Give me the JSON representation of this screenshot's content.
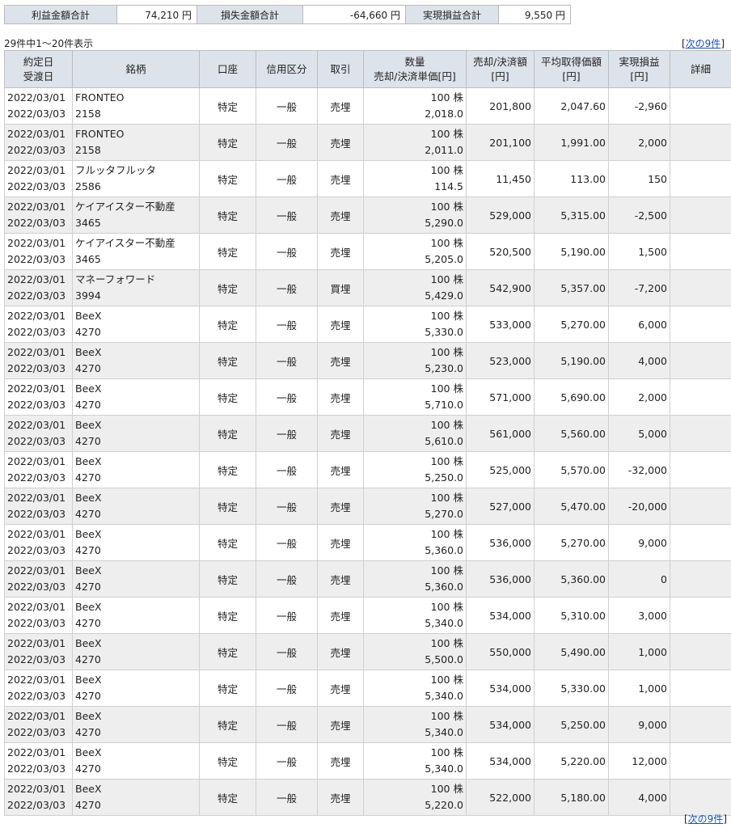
{
  "summary": {
    "profit_label": "利益金額合計",
    "profit_value": "74,210 円",
    "loss_label": "損失金額合計",
    "loss_value": "-64,660 円",
    "realized_label": "実現損益合計",
    "realized_value": "9,550 円"
  },
  "listing": {
    "count_text": "29件中1～20件表示",
    "next_link": "次の9件",
    "bracket_open": "[",
    "bracket_close": "]"
  },
  "table": {
    "headers": {
      "date_line1": "約定日",
      "date_line2": "受渡日",
      "name": "銘柄",
      "account": "口座",
      "credit": "信用区分",
      "trade": "取引",
      "qty_line1": "数量",
      "qty_line2": "売却/決済単価[円]",
      "amount_line1": "売却/決済額",
      "amount_line2": "[円]",
      "avg_line1": "平均取得価額",
      "avg_line2": "[円]",
      "pl_line1": "実現損益",
      "pl_line2": "[円]",
      "detail": "詳細"
    },
    "rows": [
      {
        "trade_date": "2022/03/01",
        "settle_date": "2022/03/03",
        "name": "FRONTEO",
        "code": "2158",
        "account": "特定",
        "credit": "一般",
        "trade": "売埋",
        "qty": "100 株",
        "price": "2,018.0",
        "amount": "201,800",
        "avg": "2,047.60",
        "pl": "-2,960"
      },
      {
        "trade_date": "2022/03/01",
        "settle_date": "2022/03/03",
        "name": "FRONTEO",
        "code": "2158",
        "account": "特定",
        "credit": "一般",
        "trade": "売埋",
        "qty": "100 株",
        "price": "2,011.0",
        "amount": "201,100",
        "avg": "1,991.00",
        "pl": "2,000"
      },
      {
        "trade_date": "2022/03/01",
        "settle_date": "2022/03/03",
        "name": "フルッタフルッタ",
        "code": "2586",
        "account": "特定",
        "credit": "一般",
        "trade": "売埋",
        "qty": "100 株",
        "price": "114.5",
        "amount": "11,450",
        "avg": "113.00",
        "pl": "150"
      },
      {
        "trade_date": "2022/03/01",
        "settle_date": "2022/03/03",
        "name": "ケイアイスター不動産",
        "code": "3465",
        "account": "特定",
        "credit": "一般",
        "trade": "売埋",
        "qty": "100 株",
        "price": "5,290.0",
        "amount": "529,000",
        "avg": "5,315.00",
        "pl": "-2,500"
      },
      {
        "trade_date": "2022/03/01",
        "settle_date": "2022/03/03",
        "name": "ケイアイスター不動産",
        "code": "3465",
        "account": "特定",
        "credit": "一般",
        "trade": "売埋",
        "qty": "100 株",
        "price": "5,205.0",
        "amount": "520,500",
        "avg": "5,190.00",
        "pl": "1,500"
      },
      {
        "trade_date": "2022/03/01",
        "settle_date": "2022/03/03",
        "name": "マネーフォワード",
        "code": "3994",
        "account": "特定",
        "credit": "一般",
        "trade": "買埋",
        "qty": "100 株",
        "price": "5,429.0",
        "amount": "542,900",
        "avg": "5,357.00",
        "pl": "-7,200"
      },
      {
        "trade_date": "2022/03/01",
        "settle_date": "2022/03/03",
        "name": "BeeX",
        "code": "4270",
        "account": "特定",
        "credit": "一般",
        "trade": "売埋",
        "qty": "100 株",
        "price": "5,330.0",
        "amount": "533,000",
        "avg": "5,270.00",
        "pl": "6,000"
      },
      {
        "trade_date": "2022/03/01",
        "settle_date": "2022/03/03",
        "name": "BeeX",
        "code": "4270",
        "account": "特定",
        "credit": "一般",
        "trade": "売埋",
        "qty": "100 株",
        "price": "5,230.0",
        "amount": "523,000",
        "avg": "5,190.00",
        "pl": "4,000"
      },
      {
        "trade_date": "2022/03/01",
        "settle_date": "2022/03/03",
        "name": "BeeX",
        "code": "4270",
        "account": "特定",
        "credit": "一般",
        "trade": "売埋",
        "qty": "100 株",
        "price": "5,710.0",
        "amount": "571,000",
        "avg": "5,690.00",
        "pl": "2,000"
      },
      {
        "trade_date": "2022/03/01",
        "settle_date": "2022/03/03",
        "name": "BeeX",
        "code": "4270",
        "account": "特定",
        "credit": "一般",
        "trade": "売埋",
        "qty": "100 株",
        "price": "5,610.0",
        "amount": "561,000",
        "avg": "5,560.00",
        "pl": "5,000"
      },
      {
        "trade_date": "2022/03/01",
        "settle_date": "2022/03/03",
        "name": "BeeX",
        "code": "4270",
        "account": "特定",
        "credit": "一般",
        "trade": "売埋",
        "qty": "100 株",
        "price": "5,250.0",
        "amount": "525,000",
        "avg": "5,570.00",
        "pl": "-32,000"
      },
      {
        "trade_date": "2022/03/01",
        "settle_date": "2022/03/03",
        "name": "BeeX",
        "code": "4270",
        "account": "特定",
        "credit": "一般",
        "trade": "売埋",
        "qty": "100 株",
        "price": "5,270.0",
        "amount": "527,000",
        "avg": "5,470.00",
        "pl": "-20,000"
      },
      {
        "trade_date": "2022/03/01",
        "settle_date": "2022/03/03",
        "name": "BeeX",
        "code": "4270",
        "account": "特定",
        "credit": "一般",
        "trade": "売埋",
        "qty": "100 株",
        "price": "5,360.0",
        "amount": "536,000",
        "avg": "5,270.00",
        "pl": "9,000"
      },
      {
        "trade_date": "2022/03/01",
        "settle_date": "2022/03/03",
        "name": "BeeX",
        "code": "4270",
        "account": "特定",
        "credit": "一般",
        "trade": "売埋",
        "qty": "100 株",
        "price": "5,360.0",
        "amount": "536,000",
        "avg": "5,360.00",
        "pl": "0"
      },
      {
        "trade_date": "2022/03/01",
        "settle_date": "2022/03/03",
        "name": "BeeX",
        "code": "4270",
        "account": "特定",
        "credit": "一般",
        "trade": "売埋",
        "qty": "100 株",
        "price": "5,340.0",
        "amount": "534,000",
        "avg": "5,310.00",
        "pl": "3,000"
      },
      {
        "trade_date": "2022/03/01",
        "settle_date": "2022/03/03",
        "name": "BeeX",
        "code": "4270",
        "account": "特定",
        "credit": "一般",
        "trade": "売埋",
        "qty": "100 株",
        "price": "5,500.0",
        "amount": "550,000",
        "avg": "5,490.00",
        "pl": "1,000"
      },
      {
        "trade_date": "2022/03/01",
        "settle_date": "2022/03/03",
        "name": "BeeX",
        "code": "4270",
        "account": "特定",
        "credit": "一般",
        "trade": "売埋",
        "qty": "100 株",
        "price": "5,340.0",
        "amount": "534,000",
        "avg": "5,330.00",
        "pl": "1,000"
      },
      {
        "trade_date": "2022/03/01",
        "settle_date": "2022/03/03",
        "name": "BeeX",
        "code": "4270",
        "account": "特定",
        "credit": "一般",
        "trade": "売埋",
        "qty": "100 株",
        "price": "5,340.0",
        "amount": "534,000",
        "avg": "5,250.00",
        "pl": "9,000"
      },
      {
        "trade_date": "2022/03/01",
        "settle_date": "2022/03/03",
        "name": "BeeX",
        "code": "4270",
        "account": "特定",
        "credit": "一般",
        "trade": "売埋",
        "qty": "100 株",
        "price": "5,340.0",
        "amount": "534,000",
        "avg": "5,220.00",
        "pl": "12,000"
      },
      {
        "trade_date": "2022/03/01",
        "settle_date": "2022/03/03",
        "name": "BeeX",
        "code": "4270",
        "account": "特定",
        "credit": "一般",
        "trade": "売埋",
        "qty": "100 株",
        "price": "5,220.0",
        "amount": "522,000",
        "avg": "5,180.00",
        "pl": "4,000"
      }
    ]
  },
  "colors": {
    "header_bg": "#dde3ea",
    "alt_row_bg": "#eeeeee",
    "link": "#1a4fb5"
  }
}
